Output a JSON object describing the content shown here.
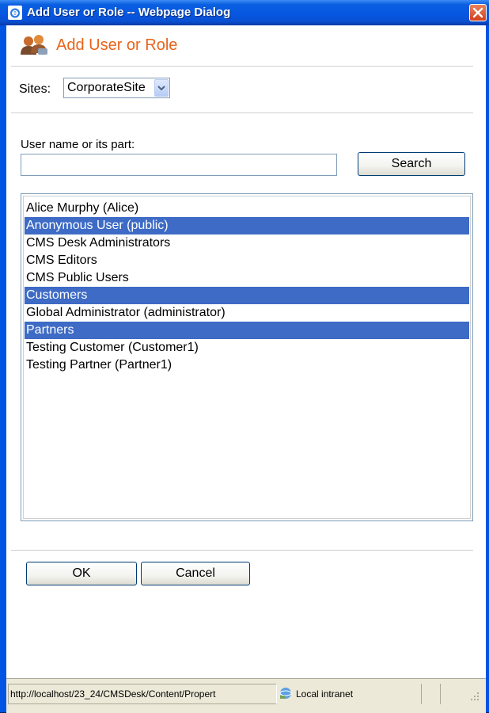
{
  "window": {
    "title": "Add User or Role -- Webpage Dialog"
  },
  "header": {
    "title": "Add User or Role",
    "icon": "users-icon"
  },
  "sites": {
    "label": "Sites:",
    "selected": "CorporateSite"
  },
  "search": {
    "label": "User name or its part:",
    "value": "",
    "button_label": "Search"
  },
  "list": {
    "items": [
      {
        "label": "Alice Murphy (Alice)",
        "selected": false
      },
      {
        "label": "Anonymous User (public)",
        "selected": true
      },
      {
        "label": "CMS Desk Administrators",
        "selected": false
      },
      {
        "label": "CMS Editors",
        "selected": false
      },
      {
        "label": "CMS Public Users",
        "selected": false
      },
      {
        "label": "Customers",
        "selected": true
      },
      {
        "label": "Global Administrator (administrator)",
        "selected": false
      },
      {
        "label": "Partners",
        "selected": true
      },
      {
        "label": "Testing Customer (Customer1)",
        "selected": false
      },
      {
        "label": "Testing Partner (Partner1)",
        "selected": false
      }
    ]
  },
  "buttons": {
    "ok": "OK",
    "cancel": "Cancel"
  },
  "statusbar": {
    "url": "http://localhost/23_24/CMSDesk/Content/Propert",
    "zone": "Local intranet"
  },
  "colors": {
    "accent": "#e8631a",
    "selection": "#3d6bc5",
    "titlebar": "#0a5fe0"
  }
}
